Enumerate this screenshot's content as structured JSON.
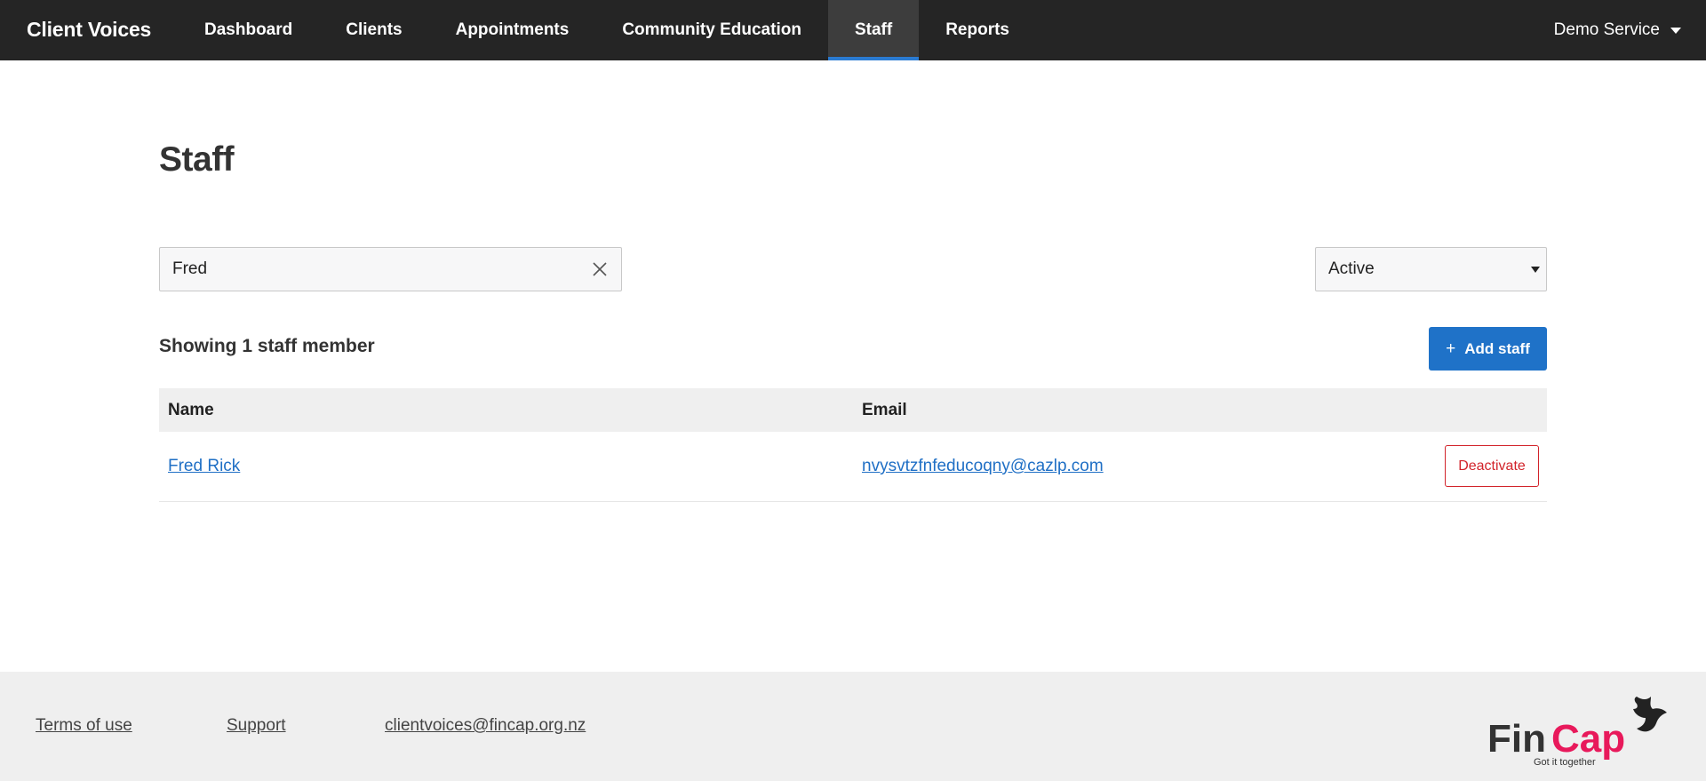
{
  "app": {
    "title": "Client Voices"
  },
  "nav": {
    "items": [
      {
        "label": "Dashboard"
      },
      {
        "label": "Clients"
      },
      {
        "label": "Appointments"
      },
      {
        "label": "Community Education"
      },
      {
        "label": "Staff",
        "active": true
      },
      {
        "label": "Reports"
      }
    ],
    "service": "Demo Service"
  },
  "page": {
    "title": "Staff"
  },
  "search": {
    "value": "Fred",
    "clear_icon": "close-icon"
  },
  "status_filter": {
    "selected": "Active"
  },
  "summary": "Showing 1 staff member",
  "add_button": {
    "label": "Add staff",
    "icon": "plus-icon"
  },
  "table": {
    "headers": {
      "name": "Name",
      "email": "Email"
    },
    "rows": [
      {
        "name": "Fred Rick",
        "email": "nvysvtzfnfeducoqny@cazlp.com",
        "action": "Deactivate"
      }
    ]
  },
  "footer": {
    "links": [
      {
        "label": "Terms of use"
      },
      {
        "label": "Support"
      },
      {
        "label": "clientvoices@fincap.org.nz"
      }
    ],
    "logo": {
      "text_fin": "Fin",
      "text_cap": "Cap",
      "tagline": "Got it together"
    }
  },
  "colors": {
    "nav_bg": "#252525",
    "accent": "#1f72c8",
    "danger": "#d2232a",
    "logo_pink": "#e8195b"
  }
}
